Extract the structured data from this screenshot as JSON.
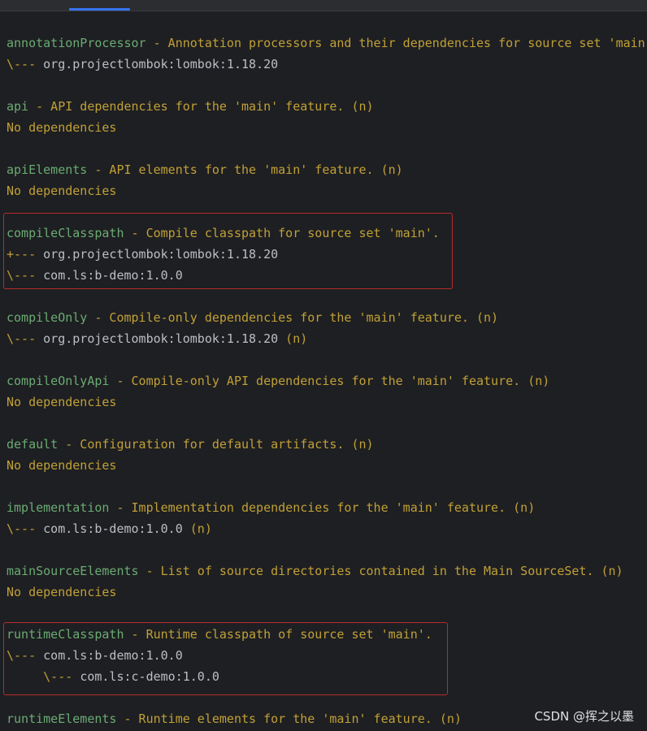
{
  "watermark": "CSDN @挥之以墨",
  "colors": {
    "background": "#1e1f22",
    "config_name": "#6aab73",
    "description": "#c0a037",
    "dependency": "#bcbec4",
    "highlight_border": "#b52d2d",
    "tab_indicator": "#3574f0"
  },
  "blocks": [
    {
      "name": "annotationProcessor",
      "desc": " - Annotation processors and their dependencies for source set 'main'.",
      "entries": [
        {
          "prefix": "\\--- ",
          "artifact": "org.projectlombok:lombok:1.18.20",
          "suffix": ""
        }
      ]
    },
    {
      "name": "api",
      "desc": " - API dependencies for the 'main' feature. (n)",
      "no_deps": "No dependencies"
    },
    {
      "name": "apiElements",
      "desc": " - API elements for the 'main' feature. (n)",
      "no_deps": "No dependencies"
    },
    {
      "name": "compileClasspath",
      "desc": " - Compile classpath for source set 'main'.",
      "entries": [
        {
          "prefix": "+--- ",
          "artifact": "org.projectlombok:lombok:1.18.20",
          "suffix": ""
        },
        {
          "prefix": "\\--- ",
          "artifact": "com.ls:b-demo:1.0.0",
          "suffix": ""
        }
      ]
    },
    {
      "name": "compileOnly",
      "desc": " - Compile-only dependencies for the 'main' feature. (n)",
      "entries": [
        {
          "prefix": "\\--- ",
          "artifact": "org.projectlombok:lombok:1.18.20",
          "suffix": " (n)"
        }
      ]
    },
    {
      "name": "compileOnlyApi",
      "desc": " - Compile-only API dependencies for the 'main' feature. (n)",
      "no_deps": "No dependencies"
    },
    {
      "name": "default",
      "desc": " - Configuration for default artifacts. (n)",
      "no_deps": "No dependencies"
    },
    {
      "name": "implementation",
      "desc": " - Implementation dependencies for the 'main' feature. (n)",
      "entries": [
        {
          "prefix": "\\--- ",
          "artifact": "com.ls:b-demo:1.0.0",
          "suffix": " (n)"
        }
      ]
    },
    {
      "name": "mainSourceElements",
      "desc": " - List of source directories contained in the Main SourceSet. (n)",
      "no_deps": "No dependencies"
    },
    {
      "name": "runtimeClasspath",
      "desc": " - Runtime classpath of source set 'main'.",
      "entries": [
        {
          "prefix": "\\--- ",
          "artifact": "com.ls:b-demo:1.0.0",
          "suffix": ""
        },
        {
          "prefix": "     \\--- ",
          "artifact": "com.ls:c-demo:1.0.0",
          "suffix": ""
        }
      ]
    },
    {
      "name": "runtimeElements",
      "desc": " - Runtime elements for the 'main' feature. (n)"
    }
  ]
}
